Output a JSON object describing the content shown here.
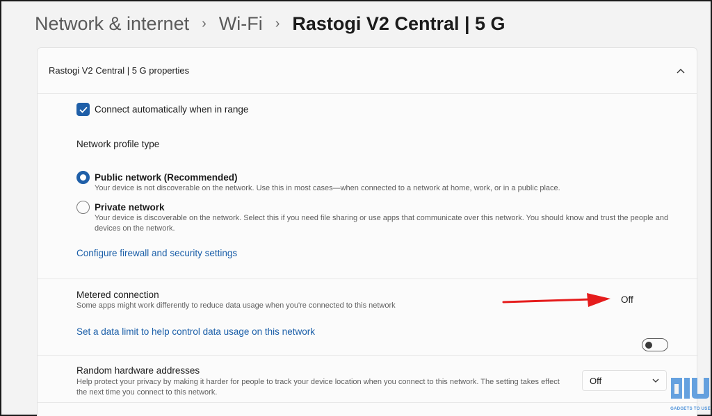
{
  "breadcrumb": {
    "items": [
      "Network & internet",
      "Wi-Fi",
      "Rastogi V2 Central |  5 G"
    ]
  },
  "card": {
    "title": "Rastogi V2 Central |  5 G properties"
  },
  "connect_auto": {
    "label": "Connect automatically when in range",
    "checked": true
  },
  "profile": {
    "heading": "Network profile type",
    "public": {
      "label": "Public network (Recommended)",
      "desc": "Your device is not discoverable on the network. Use this in most cases—when connected to a network at home, work, or in a public place.",
      "selected": true
    },
    "private": {
      "label": "Private network",
      "desc": "Your device is discoverable on the network. Select this if you need file sharing or use apps that communicate over this network. You should know and trust the people and devices on the network.",
      "selected": false
    },
    "firewall_link": "Configure firewall and security settings"
  },
  "metered": {
    "label": "Metered connection",
    "desc": "Some apps might work differently to reduce data usage when you're connected to this network",
    "state": "Off",
    "data_limit_link": "Set a data limit to help control data usage on this network"
  },
  "random_hw": {
    "label": "Random hardware addresses",
    "desc": "Help protect your privacy by making it harder for people to track your device location when you connect to this network. The setting takes effect the next time you connect to this network.",
    "value": "Off"
  },
  "colors": {
    "accent": "#1f5fa8",
    "link": "#1a5ea8",
    "arrow": "#e51c1c"
  },
  "watermark": {
    "text": "GADGETS TO USE"
  }
}
